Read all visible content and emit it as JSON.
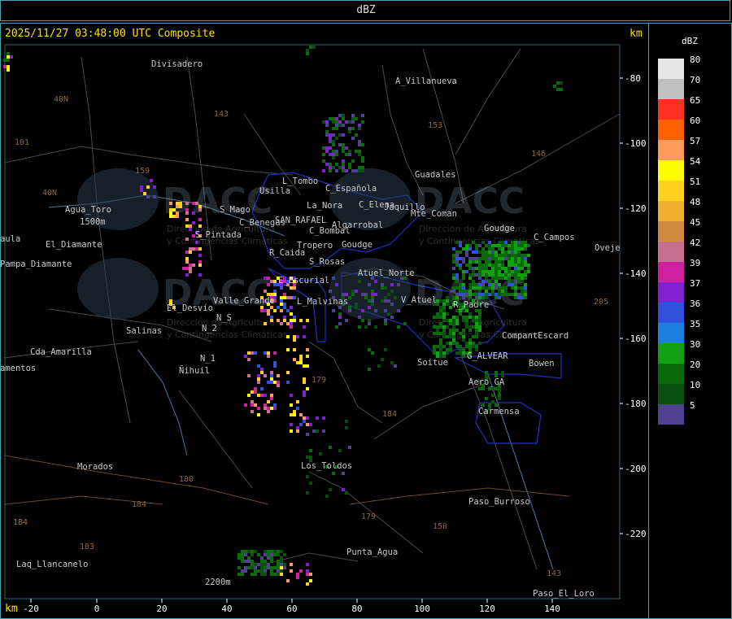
{
  "header": {
    "title": "dBZ"
  },
  "map": {
    "timestamp": "2025/11/27 03:48:00 UTC Composite",
    "km_top": "km",
    "km_bottom": "km",
    "x_ticks": [
      "-20",
      "0",
      "20",
      "40",
      "60",
      "80",
      "100",
      "120",
      "140"
    ],
    "y_ticks": [
      "-80",
      "-100",
      "-120",
      "-140",
      "-160",
      "-180",
      "-200",
      "-220"
    ],
    "watermark": {
      "logo_text": "DACC",
      "line1": "Dirección de Agricultura",
      "line2": "y Contingencias Climáticas"
    },
    "places": [
      "Divisadero",
      "A_Villanueva",
      "40N",
      "101",
      "143",
      "153",
      "146",
      "159",
      "40N",
      "Guadales",
      "Usilla",
      "L_Tombo",
      "C_Española",
      "Agua_Toro",
      "1500m",
      "La_Nora",
      "C_Elena",
      "Jaquillo",
      "Mte_Coman",
      "Goudge",
      "C_Campos",
      "Oveje",
      "S_Mago",
      "C_Benegas",
      "SAN_RAFAEL",
      "Algarrobal",
      "C_Bombal",
      "S_Pintada",
      "El_Diamante",
      "Pampa_Diamante",
      "Tropero",
      "Goudge",
      "R_Caida",
      "S_Rosas",
      "Atuel_Norte",
      "E_Escurial",
      "V_Atuel",
      "R_Padre",
      "Valle_Grande",
      "L_Malvinas",
      "205",
      "El_Desvío",
      "Salinas",
      "N_S",
      "N_2",
      "CompantEscard",
      "Cda_Amarilla",
      "N_1",
      "Ñihuil",
      "G_ALVEAR",
      "Bowen",
      "Soitue",
      "amentos",
      "179",
      "Aero_GA",
      "184",
      "Carmensa",
      "Morados",
      "Los_Toldos",
      "180",
      "184",
      "184",
      "Paso_Burroso",
      "179",
      "150",
      "184",
      "183",
      "Punta_Agua",
      "Laq_Llancanelo",
      "2200m",
      "143",
      "Paso_El_Loro",
      "aula"
    ]
  },
  "legend": {
    "title": "dBZ",
    "items": [
      {
        "value": "80",
        "color": "#e6e6e6"
      },
      {
        "value": "70",
        "color": "#c0c0c0"
      },
      {
        "value": "65",
        "color": "#ff3020"
      },
      {
        "value": "60",
        "color": "#ff6000"
      },
      {
        "value": "57",
        "color": "#ff9a5a"
      },
      {
        "value": "54",
        "color": "#ffff00"
      },
      {
        "value": "51",
        "color": "#ffd020"
      },
      {
        "value": "48",
        "color": "#f0b030"
      },
      {
        "value": "45",
        "color": "#d08a40"
      },
      {
        "value": "42",
        "color": "#c87090"
      },
      {
        "value": "39",
        "color": "#d020a0"
      },
      {
        "value": "37",
        "color": "#8020d0"
      },
      {
        "value": "36",
        "color": "#3050e0"
      },
      {
        "value": "35",
        "color": "#1a80e0"
      },
      {
        "value": "30",
        "color": "#10a010"
      },
      {
        "value": "20",
        "color": "#0a6a0a"
      },
      {
        "value": "10",
        "color": "#0a5010"
      },
      {
        "value": "5",
        "color": "#504090"
      }
    ]
  }
}
